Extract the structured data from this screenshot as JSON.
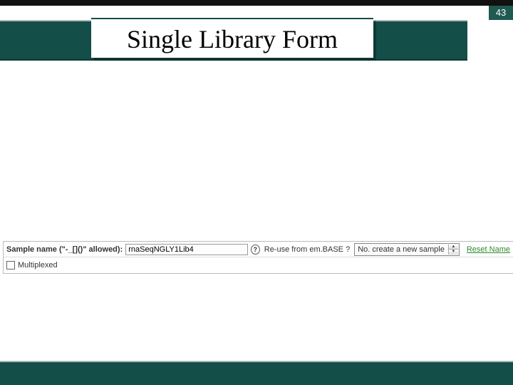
{
  "page_number": "43",
  "title": "Single Library Form",
  "form": {
    "sample_label": "Sample name (\"-_[]()\" allowed):",
    "sample_value": "rnaSeqNGLY1Lib4",
    "help_icon_text": "?",
    "reuse_label": "Re-use from em.BASE ?",
    "reuse_select_value": "No. create a new sample",
    "reset_link": "Reset Name",
    "multiplexed_label": "Multiplexed"
  }
}
